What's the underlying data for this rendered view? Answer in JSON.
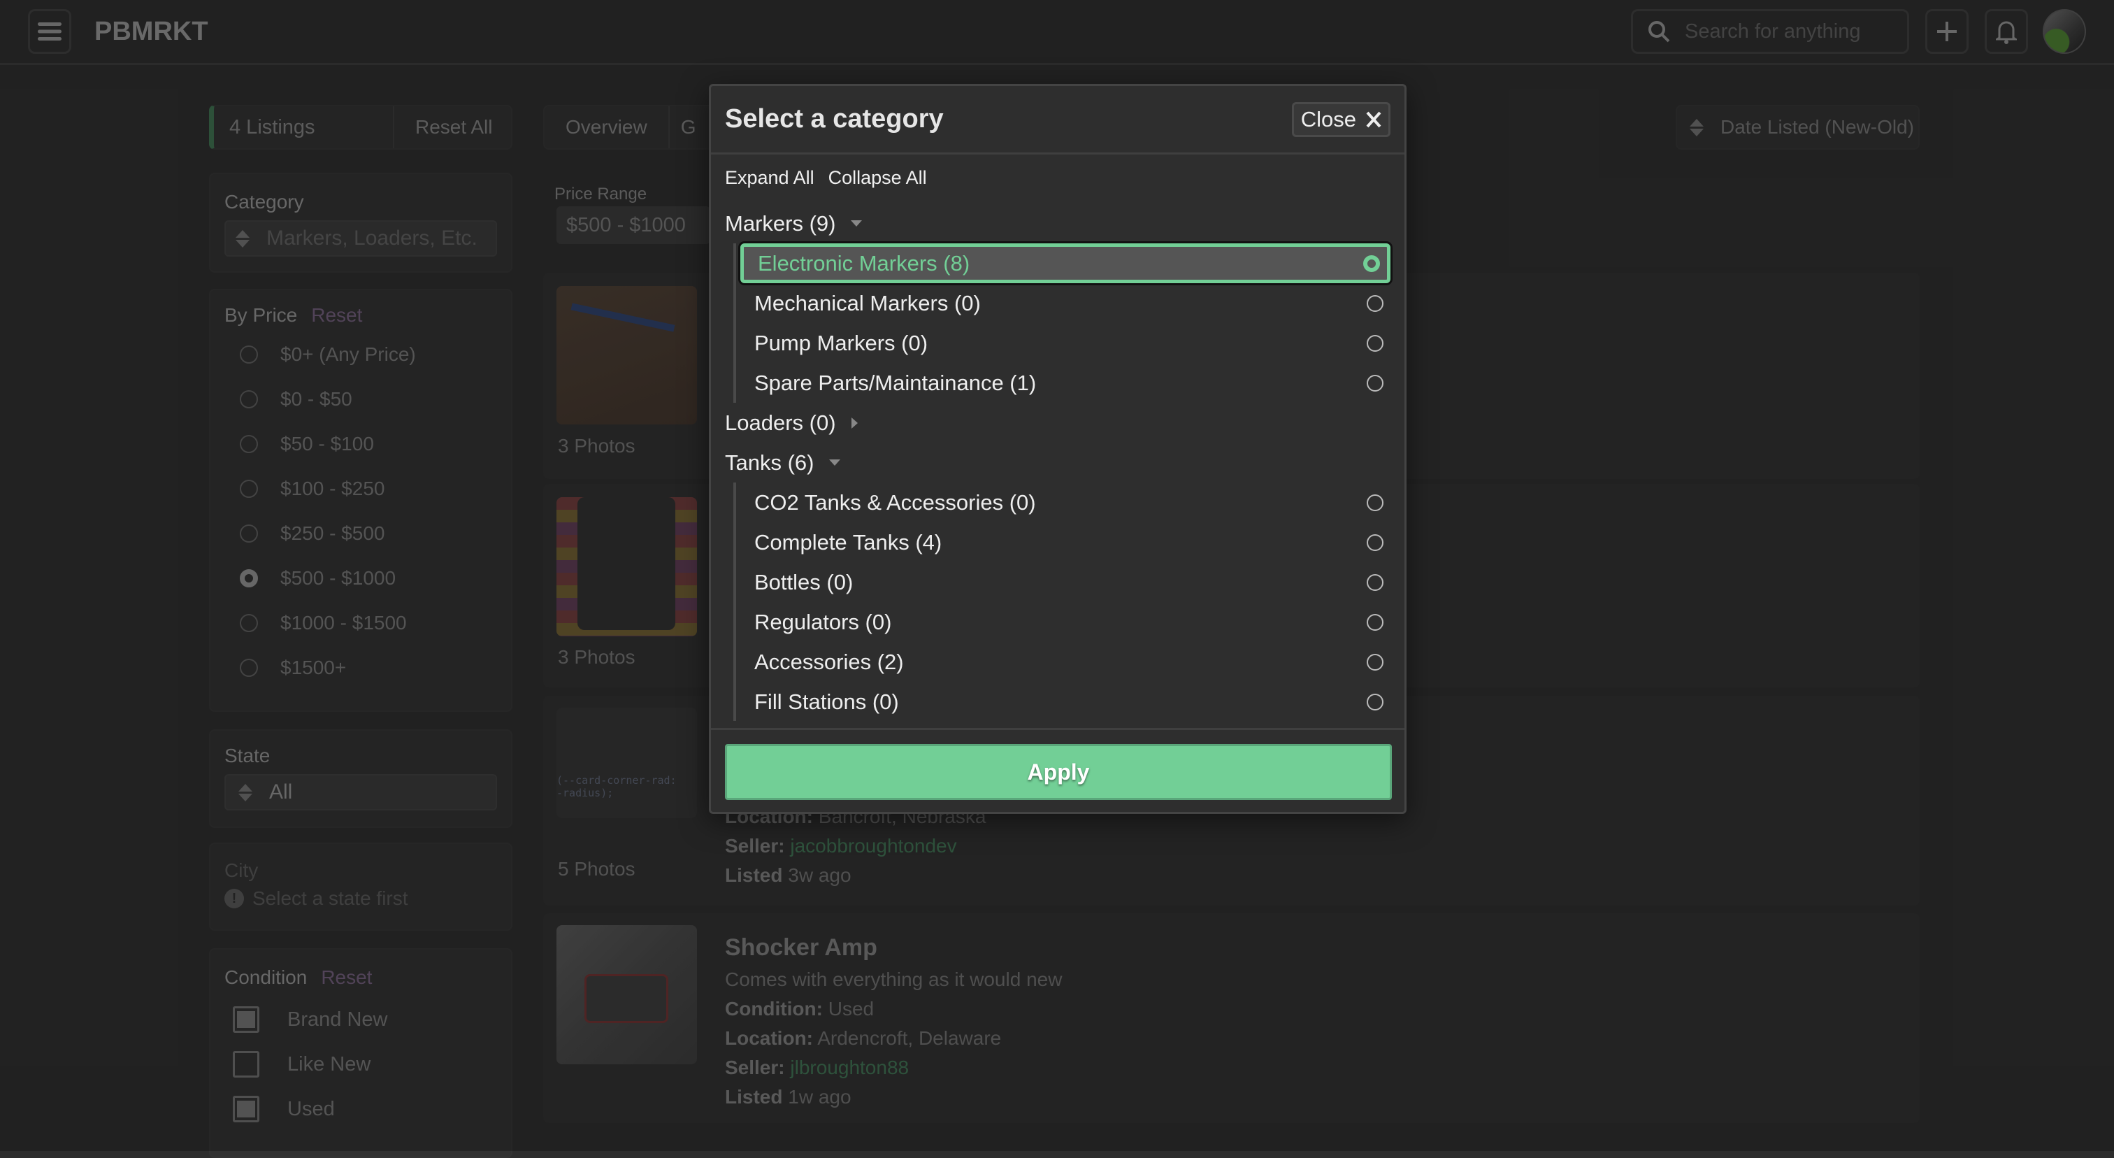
{
  "header": {
    "brand": "PBMRKT",
    "search_placeholder": "Search for anything"
  },
  "toolbar": {
    "listings": "4 Listings",
    "reset_all": "Reset All",
    "tabs": [
      "Overview",
      "G"
    ],
    "sort": "Date Listed (New-Old)"
  },
  "filters": {
    "category": {
      "label": "Category",
      "placeholder": "Markers, Loaders, Etc."
    },
    "price": {
      "label": "By Price",
      "reset": "Reset",
      "options": [
        "$0+ (Any Price)",
        "$0 - $50",
        "$50 - $100",
        "$100 - $250",
        "$250 - $500",
        "$500 - $1000",
        "$1000 - $1500",
        "$1500+"
      ],
      "selected": 5
    },
    "state": {
      "label": "State",
      "value": "All"
    },
    "city": {
      "label": "City",
      "hint": "Select a state first"
    },
    "condition": {
      "label": "Condition",
      "reset": "Reset",
      "options": [
        {
          "label": "Brand New",
          "checked": true
        },
        {
          "label": "Like New",
          "checked": false
        },
        {
          "label": "Used",
          "checked": true
        }
      ]
    }
  },
  "main": {
    "price_range_label": "Price Range",
    "price_range_value": "$500 - $1000",
    "listings": [
      {
        "photos": "3 Photos"
      },
      {
        "photos": "3 Photos"
      },
      {
        "photos": "5 Photos",
        "code": "(--card-corner-rad:\n-radius);",
        "location_label": "Location:",
        "location": "Bancroft, Nebraska",
        "seller_label": "Seller:",
        "seller": "jacobbroughtondev",
        "listed_label": "Listed",
        "listed": "3w ago"
      },
      {
        "photos": "",
        "title": "Shocker Amp",
        "desc": "Comes with everything as it would new",
        "condition_label": "Condition:",
        "condition": "Used",
        "location_label": "Location:",
        "location": "Ardencroft, Delaware",
        "seller_label": "Seller:",
        "seller": "jlbroughton88",
        "listed_label": "Listed",
        "listed": "1w ago"
      }
    ]
  },
  "modal": {
    "title": "Select a category",
    "close": "Close",
    "expand_all": "Expand All",
    "collapse_all": "Collapse All",
    "apply": "Apply",
    "groups": [
      {
        "label": "Markers (9)",
        "expanded": true,
        "items": [
          "Electronic Markers (8)",
          "Mechanical Markers (0)",
          "Pump Markers (0)",
          "Spare Parts/Maintainance (1)"
        ]
      },
      {
        "label": "Loaders (0)",
        "expanded": false,
        "items": []
      },
      {
        "label": "Tanks (6)",
        "expanded": true,
        "items": [
          "CO2 Tanks & Accessories (0)",
          "Complete Tanks (4)",
          "Bottles (0)",
          "Regulators (0)",
          "Accessories (2)",
          "Fill Stations (0)"
        ]
      }
    ],
    "selected": "Electronic Markers (8)"
  },
  "colors": {
    "accent": "#72cf96",
    "reset": "#6d5a76",
    "seller": "#3e6e50"
  }
}
